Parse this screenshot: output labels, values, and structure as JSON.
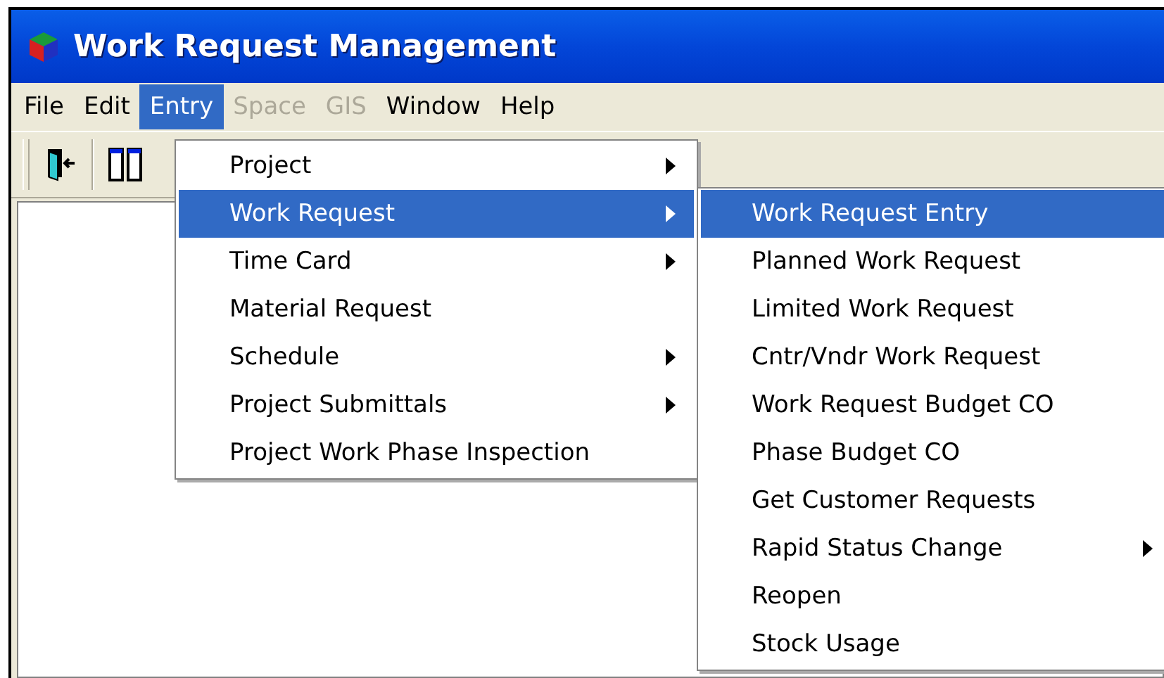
{
  "window": {
    "title": "Work Request Management"
  },
  "menubar": [
    {
      "label": "File",
      "disabled": false,
      "selected": false
    },
    {
      "label": "Edit",
      "disabled": false,
      "selected": false
    },
    {
      "label": "Entry",
      "disabled": false,
      "selected": true
    },
    {
      "label": "Space",
      "disabled": true,
      "selected": false
    },
    {
      "label": "GIS",
      "disabled": true,
      "selected": false
    },
    {
      "label": "Window",
      "disabled": false,
      "selected": false
    },
    {
      "label": "Help",
      "disabled": false,
      "selected": false
    }
  ],
  "entry_menu": [
    {
      "label": "Project",
      "submenu": true,
      "selected": false
    },
    {
      "label": "Work Request",
      "submenu": true,
      "selected": true
    },
    {
      "label": "Time Card",
      "submenu": true,
      "selected": false
    },
    {
      "label": "Material Request",
      "submenu": false,
      "selected": false
    },
    {
      "label": "Schedule",
      "submenu": true,
      "selected": false
    },
    {
      "label": "Project Submittals",
      "submenu": true,
      "selected": false
    },
    {
      "label": "Project Work Phase Inspection",
      "submenu": false,
      "selected": false
    }
  ],
  "work_request_menu": [
    {
      "label": "Work Request Entry",
      "submenu": false,
      "selected": true
    },
    {
      "label": "Planned Work Request",
      "submenu": false,
      "selected": false
    },
    {
      "label": "Limited Work Request",
      "submenu": false,
      "selected": false
    },
    {
      "label": "Cntr/Vndr Work Request",
      "submenu": false,
      "selected": false
    },
    {
      "label": "Work Request Budget CO",
      "submenu": false,
      "selected": false
    },
    {
      "label": "Phase Budget CO",
      "submenu": false,
      "selected": false
    },
    {
      "label": "Get Customer Requests",
      "submenu": false,
      "selected": false
    },
    {
      "label": "Rapid Status Change",
      "submenu": true,
      "selected": false
    },
    {
      "label": "Reopen",
      "submenu": false,
      "selected": false
    },
    {
      "label": "Stock Usage",
      "submenu": false,
      "selected": false
    }
  ]
}
